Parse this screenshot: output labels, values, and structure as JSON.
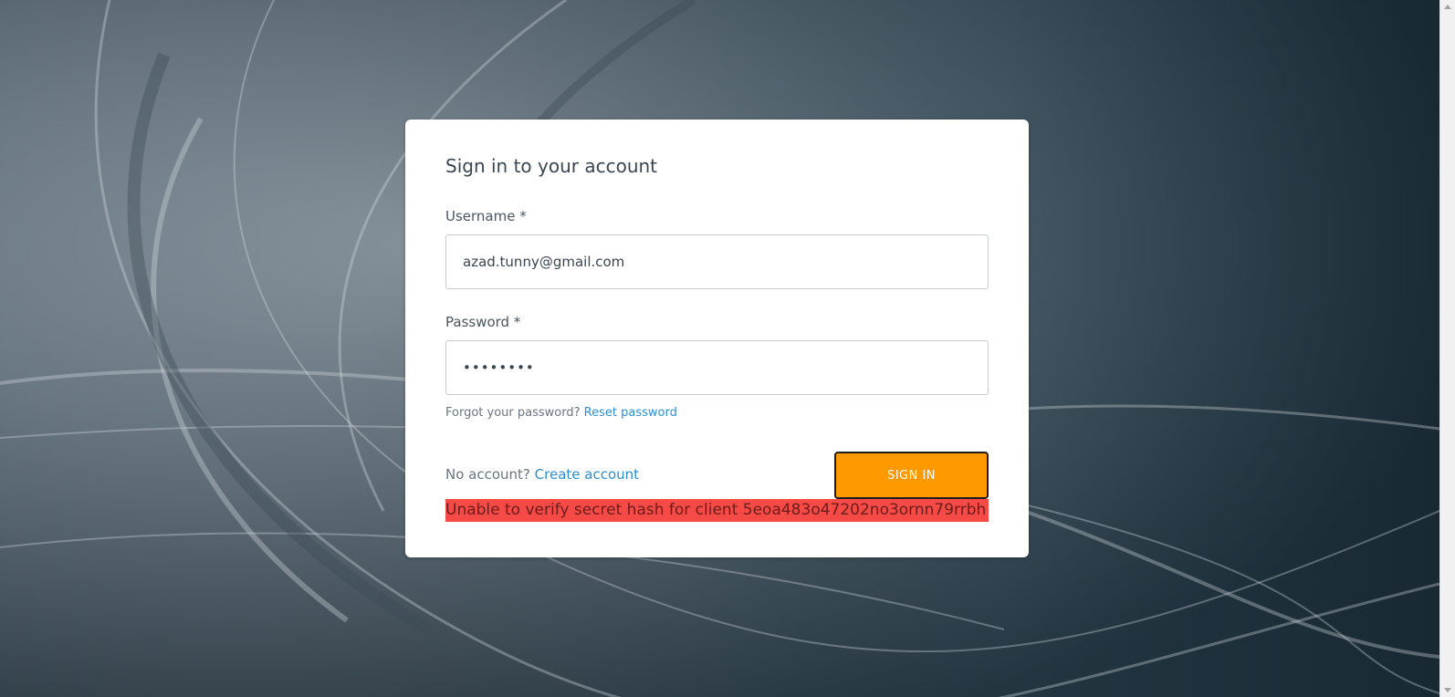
{
  "signin": {
    "title": "Sign in to your account",
    "username_label": "Username *",
    "username_value": "azad.tunny@gmail.com",
    "password_label": "Password *",
    "password_value": "••••••••",
    "forgot_text": "Forgot your password?",
    "reset_link": "Reset password",
    "no_account_text": "No account?",
    "create_account_link": "Create account",
    "signin_button": "SIGN IN",
    "error_message": "Unable to verify secret hash for client 5eoa483o47202no3ornn79rrbh"
  },
  "colors": {
    "accent": "#ff9900",
    "link": "#2a8fd3",
    "error_bg": "#f54a45"
  },
  "icons": {
    "scroll_up": "scroll-up-arrow-icon",
    "scroll_down": "scroll-down-arrow-icon"
  }
}
